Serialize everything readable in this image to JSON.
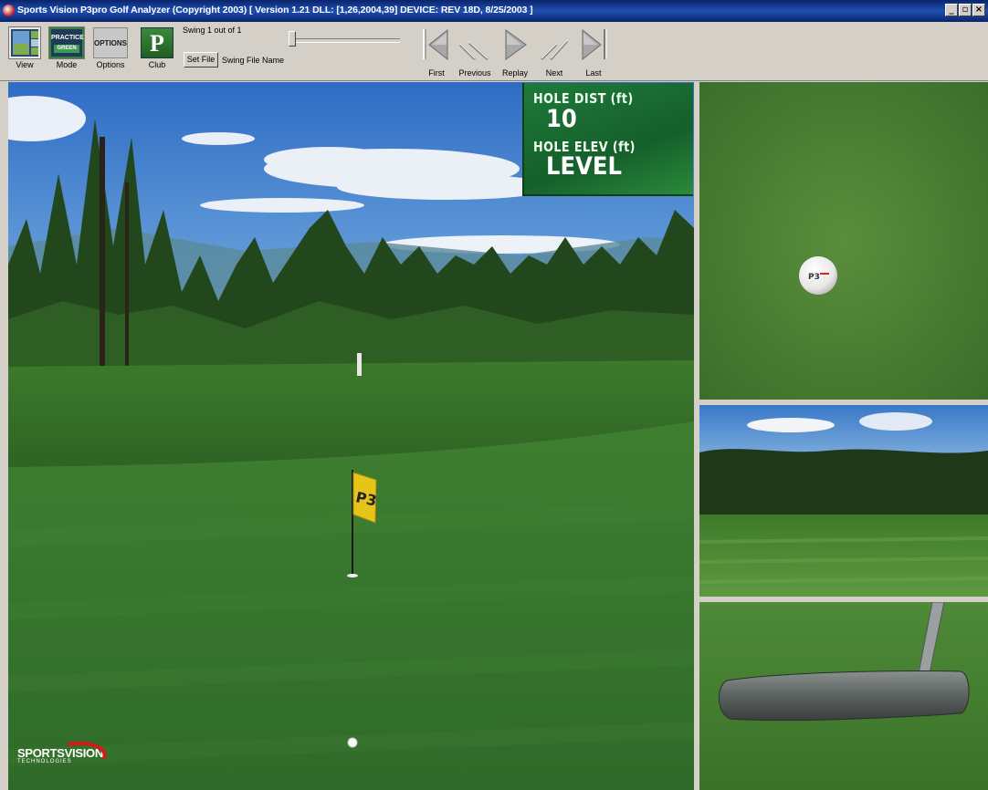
{
  "window": {
    "title": "Sports Vision P3pro Golf Analyzer (Copyright 2003)   [ Version 1.21  DLL: [1,26,2004,39]  DEVICE: REV 18D, 8/25/2003 ]",
    "minimize": "_",
    "maximize": "▫",
    "close": "×"
  },
  "toolbar": {
    "view_label": "View",
    "mode_label": "Mode",
    "mode_icon_text": "PRACTICE",
    "mode_icon_sub": "GREEN",
    "options_label": "Options",
    "options_icon_text": "OPTIONS",
    "club_label": "Club",
    "club_icon_text": "P",
    "swing_info": "Swing 1 out of 1",
    "set_file_label": "Set File",
    "swing_file_name": "Swing File Name",
    "nav": {
      "first": "First",
      "previous": "Previous",
      "replay": "Replay",
      "next": "Next",
      "last": "Last"
    }
  },
  "hud": {
    "dist_label": "HOLE DIST (ft)",
    "dist_value": "10",
    "elev_label": "HOLE ELEV (ft)",
    "elev_value": "LEVEL"
  },
  "flag_number": "P3",
  "ball_logo": "P3",
  "logo": {
    "brand": "SPORTSVISION",
    "sub": "TECHNOLOGIES"
  },
  "colors": {
    "titlebar": "#0a246a",
    "hud_green": "#1f7a3a",
    "grass": "#3e7a2e",
    "sky": "#4a86cf"
  }
}
